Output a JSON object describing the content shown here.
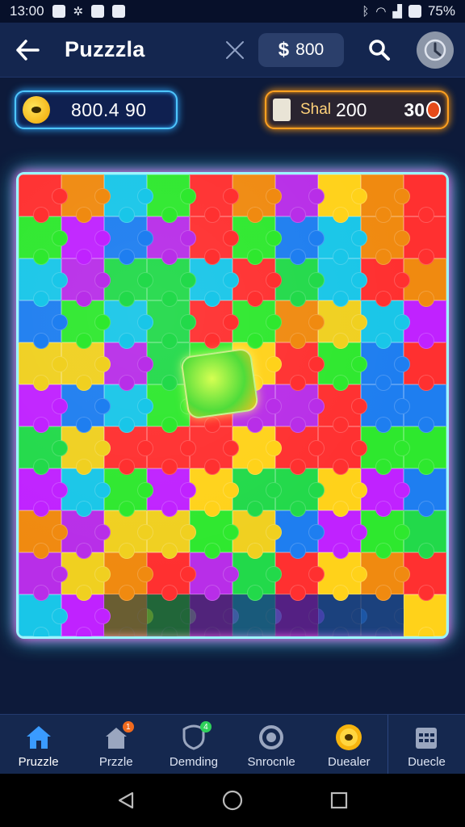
{
  "status_bar": {
    "time": "13:00",
    "battery": "75%",
    "signal_text": "ᛒ"
  },
  "app_bar": {
    "title": "Puzzzla",
    "balance_symbol": "$",
    "balance_value": "800"
  },
  "stats": {
    "coins": "800.4 90",
    "shop_label": "Shal",
    "shop_value": "200",
    "shop_value2": "30"
  },
  "board": {
    "rows": 11,
    "cols": 10,
    "palette": [
      "#b82ee8",
      "#19c6e8",
      "#2ee82e",
      "#f0d020",
      "#ff3030",
      "#f08a10",
      "#1e7ef0",
      "#c022ff",
      "#ffd21a",
      "#22d94a"
    ]
  },
  "nav": {
    "items": [
      {
        "label": "Pruzzle",
        "icon": "home-icon",
        "badge": ""
      },
      {
        "label": "Przzle",
        "icon": "puzzle-house-icon",
        "badge": "1"
      },
      {
        "label": "Demding",
        "icon": "shield-icon",
        "badge": "4"
      },
      {
        "label": "Snrocnle",
        "icon": "target-icon",
        "badge": ""
      },
      {
        "label": "Duealer",
        "icon": "coin-icon",
        "badge": ""
      },
      {
        "label": "Duecle",
        "icon": "calendar-icon",
        "badge": ""
      }
    ]
  },
  "colors": {
    "accent_blue": "#4ec6ff",
    "accent_orange": "#ffa020",
    "badge_orange": "#f06a1e",
    "badge_green": "#2ed15a"
  }
}
